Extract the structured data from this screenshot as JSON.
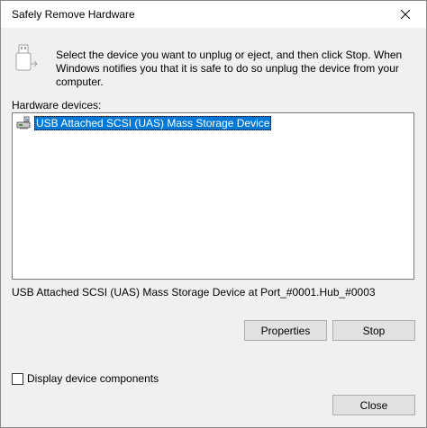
{
  "window": {
    "title": "Safely Remove Hardware"
  },
  "instructions": "Select the device you want to unplug or eject, and then click Stop. When Windows notifies you that it is safe to do so unplug the device from your computer.",
  "hardware": {
    "label": "Hardware devices:",
    "devices": [
      {
        "name": "USB Attached SCSI (UAS) Mass Storage Device",
        "selected": true,
        "icon": "usb-drive-icon"
      }
    ],
    "selected_description": "USB Attached SCSI (UAS) Mass Storage Device at Port_#0001.Hub_#0003"
  },
  "buttons": {
    "properties": "Properties",
    "stop": "Stop",
    "close": "Close"
  },
  "options": {
    "display_components_label": "Display device components",
    "display_components_checked": false
  },
  "colors": {
    "selection": "#0078d7",
    "dialog_bg": "#f0f0f0",
    "button_bg": "#e1e1e1"
  }
}
